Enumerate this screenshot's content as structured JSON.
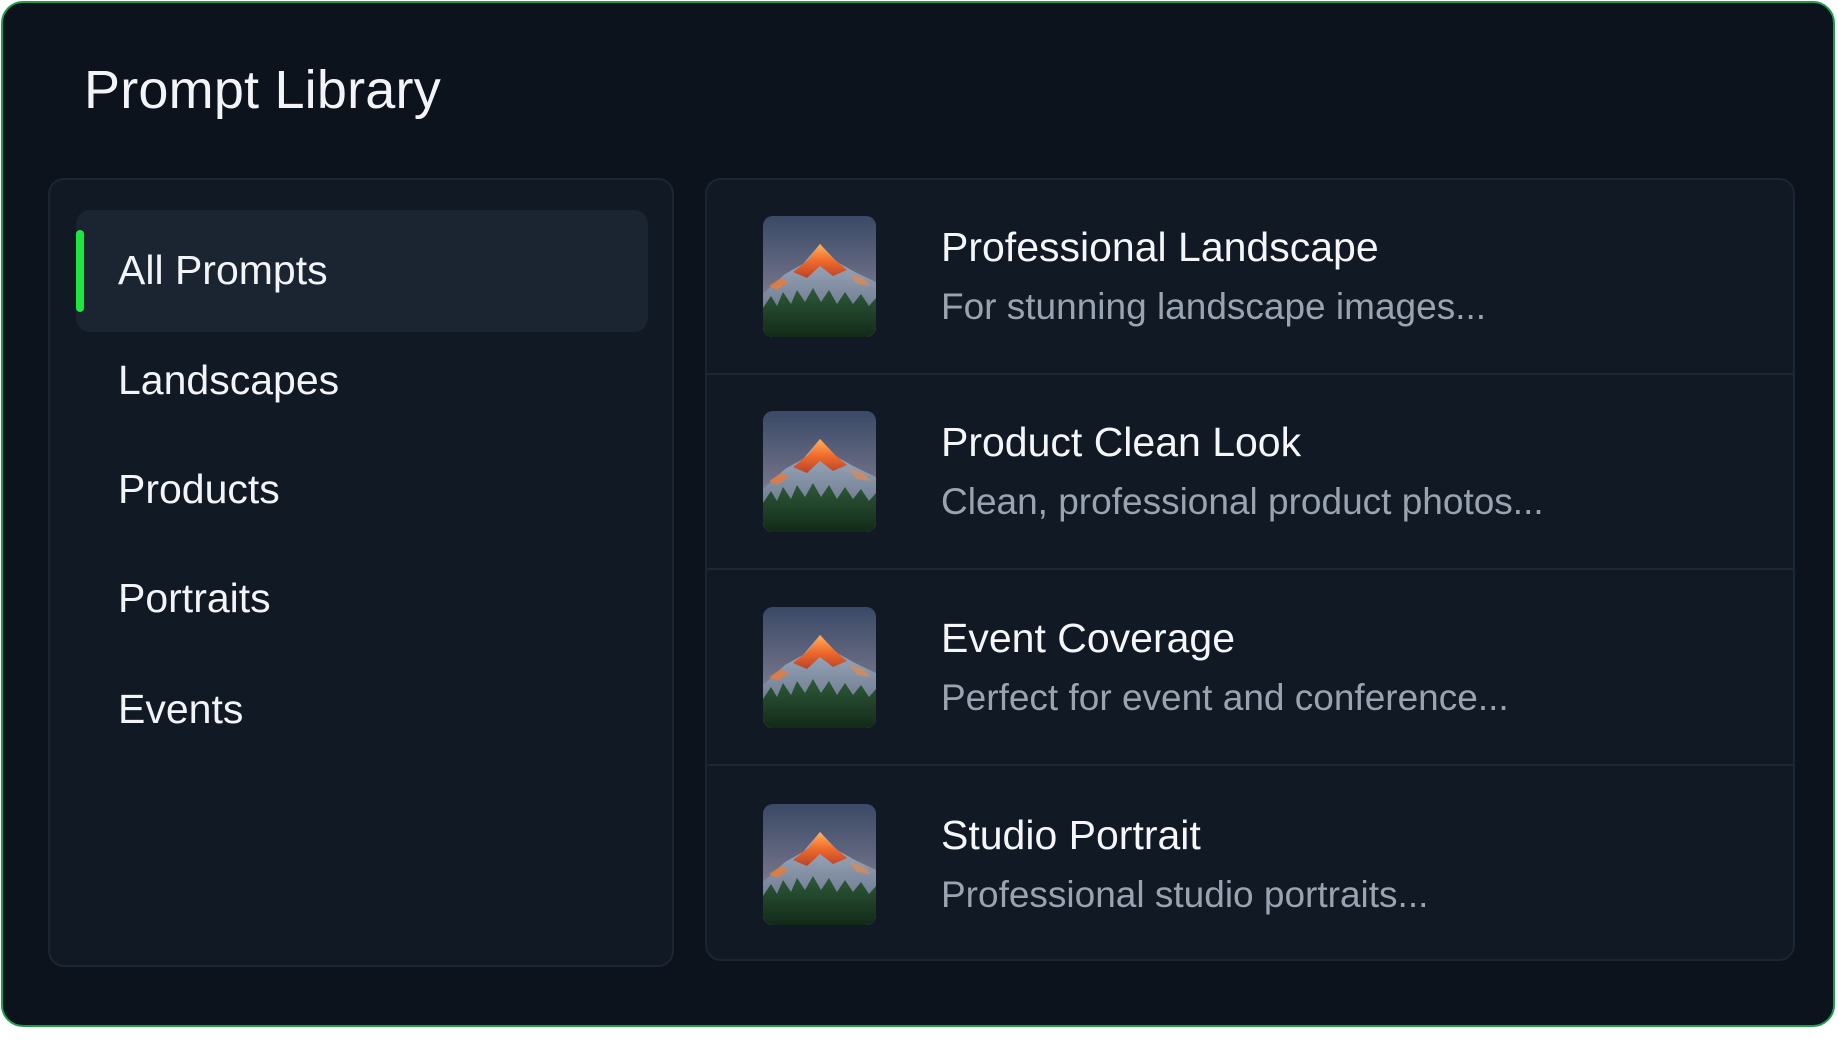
{
  "app": {
    "title": "Prompt Library",
    "accent_color": "#1ee63e",
    "frame_border_color": "#1f9d4d"
  },
  "sidebar": {
    "items": [
      {
        "label": "All Prompts",
        "active": true
      },
      {
        "label": "Landscapes",
        "active": false
      },
      {
        "label": "Products",
        "active": false
      },
      {
        "label": "Portraits",
        "active": false
      },
      {
        "label": "Events",
        "active": false
      }
    ]
  },
  "prompts": [
    {
      "title": "Professional Landscape",
      "description": "For stunning landscape images...",
      "thumbnail": "mountain-sunset-thumbnail"
    },
    {
      "title": "Product Clean Look",
      "description": "Clean, professional product photos...",
      "thumbnail": "mountain-sunset-thumbnail"
    },
    {
      "title": "Event Coverage",
      "description": "Perfect for event and conference...",
      "thumbnail": "mountain-sunset-thumbnail"
    },
    {
      "title": "Studio Portrait",
      "description": "Professional studio portraits...",
      "thumbnail": "mountain-sunset-thumbnail"
    }
  ]
}
